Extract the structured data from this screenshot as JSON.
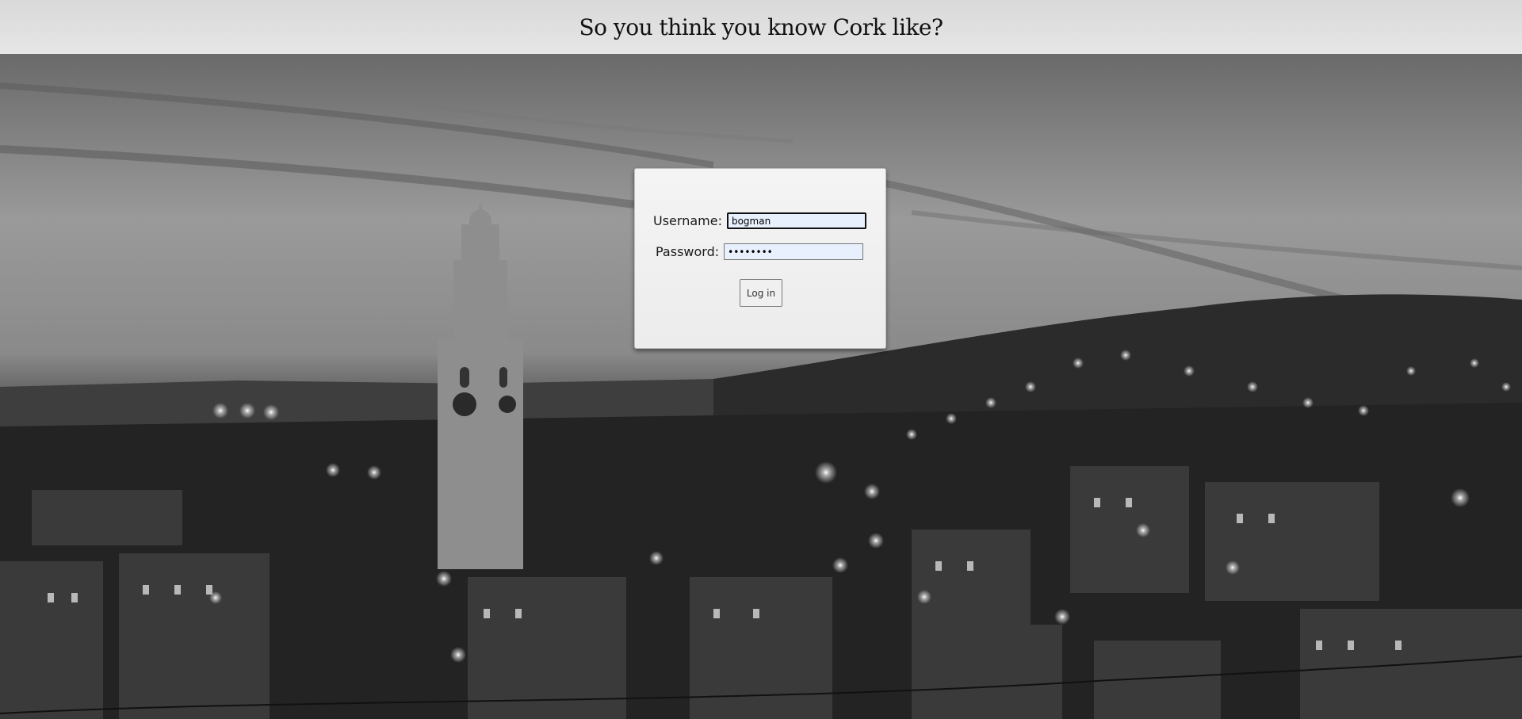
{
  "header": {
    "title": "So you think you know Cork like?"
  },
  "login": {
    "username_label": "Username:",
    "username_value": "bogman",
    "password_label": "Password:",
    "password_value": "password",
    "submit_label": "Log in"
  },
  "colors": {
    "header_bg": "#e0e0e0",
    "panel_bg": "#f2f2f2",
    "input_autofill": "#e8f0fe"
  }
}
